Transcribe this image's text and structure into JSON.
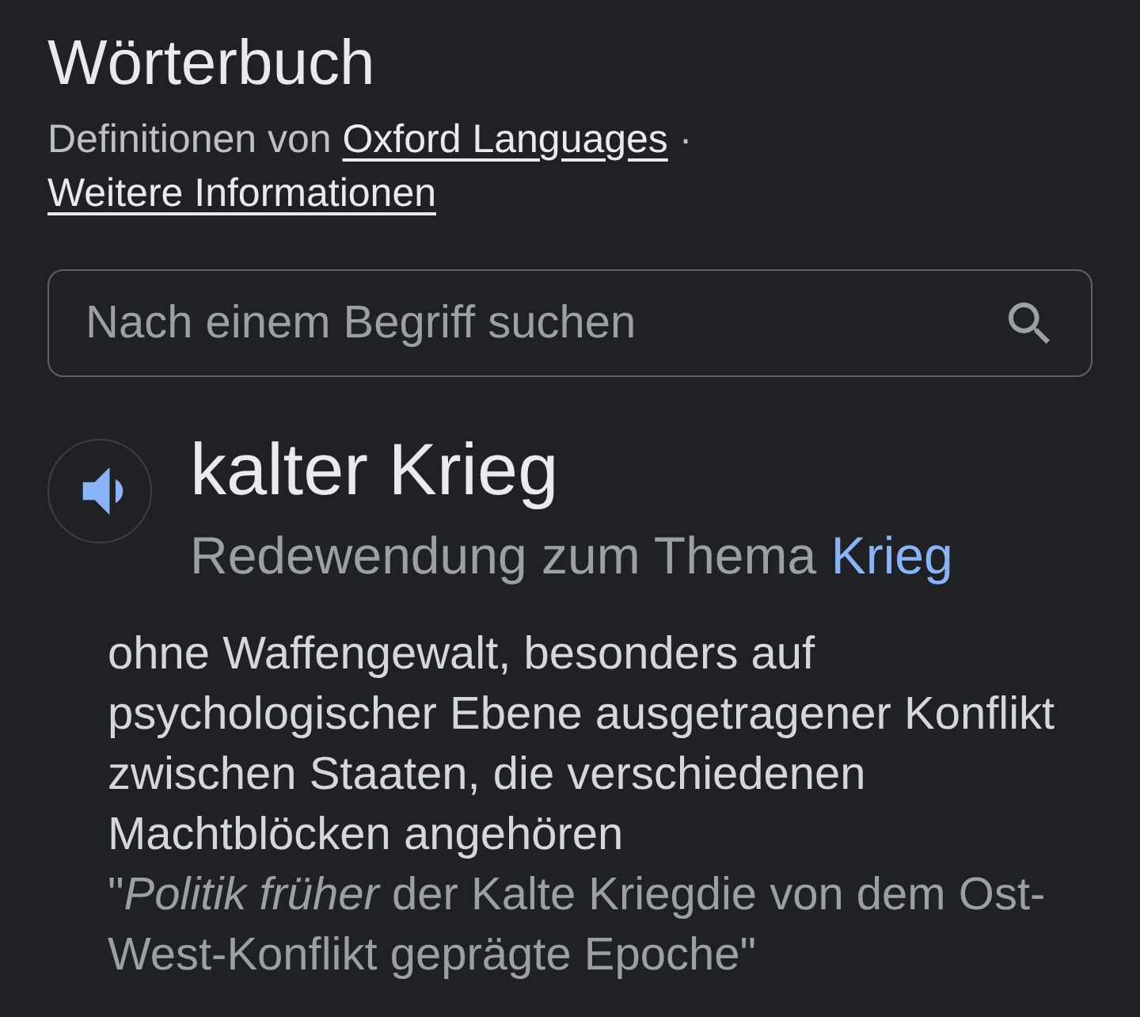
{
  "title": "Wörterbuch",
  "source": {
    "prefix": "Definitionen von",
    "link": "Oxford Languages",
    "separator": "·",
    "more_link": "Weitere Informationen"
  },
  "search": {
    "placeholder": "Nach einem Begriff suchen"
  },
  "entry": {
    "headword": "kalter Krieg",
    "category": {
      "prefix": "Redewendung zum Thema",
      "topic_link": "Krieg"
    },
    "definition": "ohne Waffengewalt, besonders auf psychologischer Ebene ausgetragener Konflikt zwischen Staaten, die verschiedenen Machtblöcken angehören",
    "example": "\"*Politik früher* der Kalte Kriegdie von dem Ost-West-Konflikt geprägte Epoche\""
  }
}
